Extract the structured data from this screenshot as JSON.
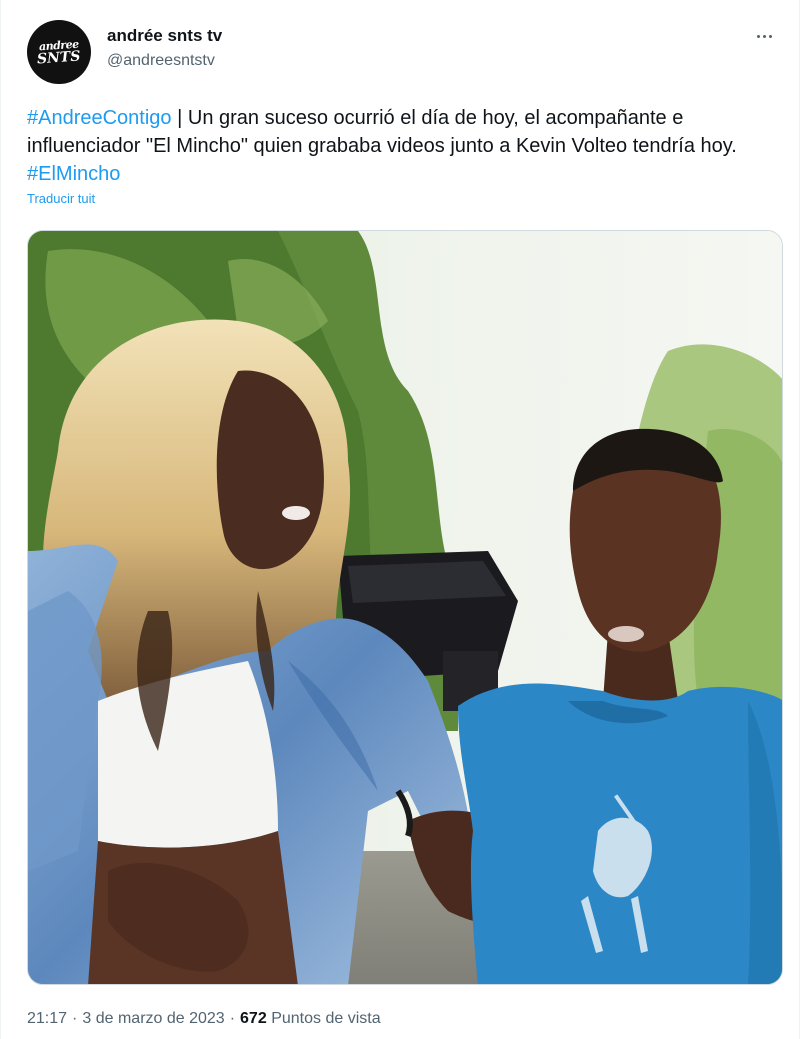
{
  "author": {
    "display_name": "andrée snts tv",
    "handle": "@andreesntstv",
    "avatar_text_line1": "andree",
    "avatar_text_line2": "SNTS"
  },
  "tweet": {
    "hashtag_1": "#AndreeContigo",
    "body": " | Un gran suceso ocurrió el día de hoy, el acompañante e influenciador \"El Mincho\" quien grababa videos junto a Kevin Volteo tendría hoy. ",
    "hashtag_2": "#ElMincho",
    "translate_label": "Traducir tuit"
  },
  "media": {
    "description": "photo",
    "icon": "photo-icon"
  },
  "meta": {
    "time": "21:17",
    "separator": "·",
    "date": "3 de marzo de 2023",
    "views_count": "672",
    "views_label": "Puntos de vista"
  },
  "menu": {
    "icon": "more-options-icon"
  },
  "colors": {
    "accent": "#1d9bf0",
    "text_primary": "#0f1419",
    "text_secondary": "#536471",
    "border": "#cfd9de"
  }
}
